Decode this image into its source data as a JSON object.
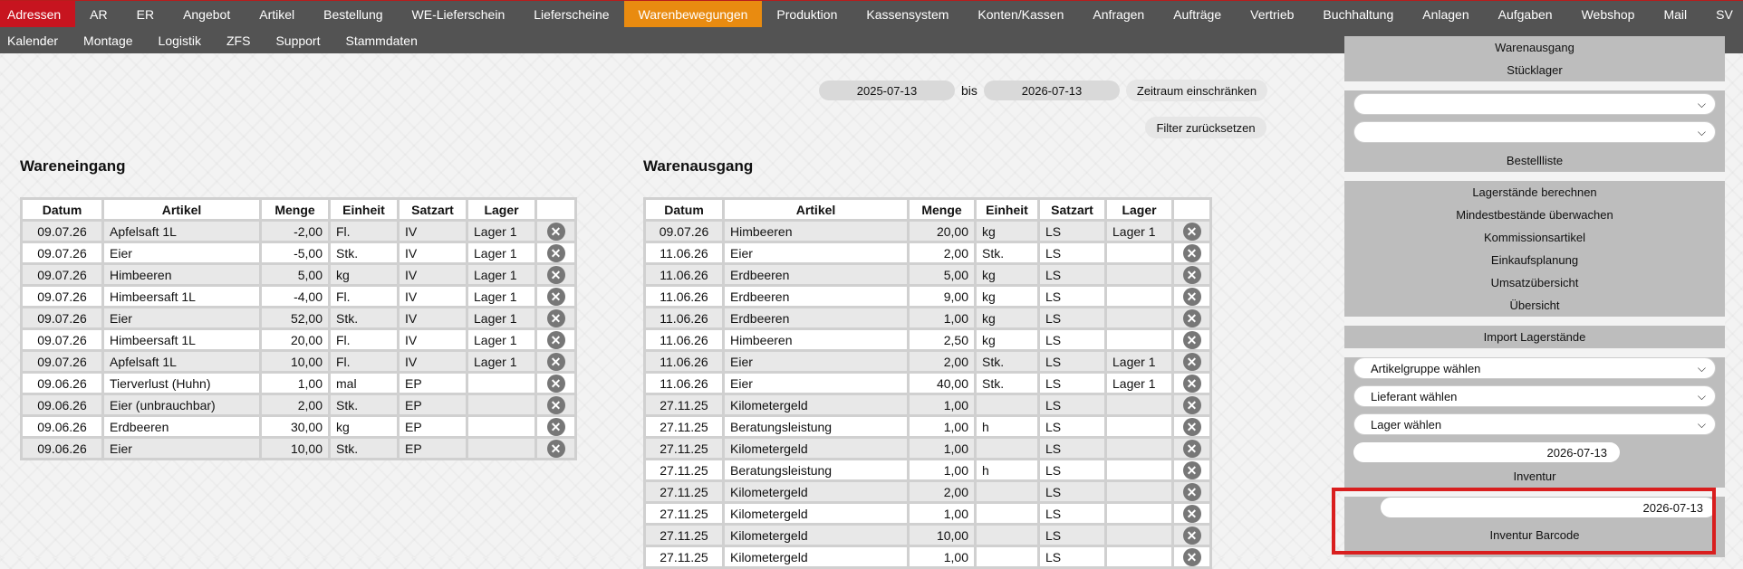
{
  "nav": {
    "row1": [
      "Adressen",
      "AR",
      "ER",
      "Angebot",
      "Artikel",
      "Bestellung",
      "WE-Lieferschein",
      "Lieferscheine",
      "Warenbewegungen",
      "Produktion",
      "Kassensystem",
      "Konten/Kassen",
      "Anfragen",
      "Aufträge",
      "Vertrieb",
      "Buchhaltung",
      "Anlagen",
      "Aufgaben",
      "Webshop",
      "Mail",
      "SV"
    ],
    "row2": [
      "Kalender",
      "Montage",
      "Logistik",
      "ZFS",
      "Support",
      "Stammdaten"
    ],
    "active": "Warenbewegungen",
    "highlighted": "Adressen"
  },
  "filter": {
    "date_from": "2025-07-13",
    "bis_label": "bis",
    "date_to": "2026-07-13",
    "restrict_label": "Zeitraum einschränken",
    "reset_label": "Filter zurücksetzen"
  },
  "wareneingang": {
    "title": "Wareneingang",
    "columns": [
      "Datum",
      "Artikel",
      "Menge",
      "Einheit",
      "Satzart",
      "Lager"
    ],
    "rows": [
      [
        "09.07.26",
        "Apfelsaft 1L",
        "-2,00",
        "Fl.",
        "IV",
        "Lager 1"
      ],
      [
        "09.07.26",
        "Eier",
        "-5,00",
        "Stk.",
        "IV",
        "Lager 1"
      ],
      [
        "09.07.26",
        "Himbeeren",
        "5,00",
        "kg",
        "IV",
        "Lager 1"
      ],
      [
        "09.07.26",
        "Himbeersaft 1L",
        "-4,00",
        "Fl.",
        "IV",
        "Lager 1"
      ],
      [
        "09.07.26",
        "Eier",
        "52,00",
        "Stk.",
        "IV",
        "Lager 1"
      ],
      [
        "09.07.26",
        "Himbeersaft 1L",
        "20,00",
        "Fl.",
        "IV",
        "Lager 1"
      ],
      [
        "09.07.26",
        "Apfelsaft 1L",
        "10,00",
        "Fl.",
        "IV",
        "Lager 1"
      ],
      [
        "09.06.26",
        "Tierverlust (Huhn)",
        "1,00",
        "mal",
        "EP",
        ""
      ],
      [
        "09.06.26",
        "Eier (unbrauchbar)",
        "2,00",
        "Stk.",
        "EP",
        ""
      ],
      [
        "09.06.26",
        "Erdbeeren",
        "30,00",
        "kg",
        "EP",
        ""
      ],
      [
        "09.06.26",
        "Eier",
        "10,00",
        "Stk.",
        "EP",
        ""
      ]
    ]
  },
  "warenausgang": {
    "title": "Warenausgang",
    "columns": [
      "Datum",
      "Artikel",
      "Menge",
      "Einheit",
      "Satzart",
      "Lager"
    ],
    "rows": [
      [
        "09.07.26",
        "Himbeeren",
        "20,00",
        "kg",
        "LS",
        "Lager 1"
      ],
      [
        "11.06.26",
        "Eier",
        "2,00",
        "Stk.",
        "LS",
        ""
      ],
      [
        "11.06.26",
        "Erdbeeren",
        "5,00",
        "kg",
        "LS",
        ""
      ],
      [
        "11.06.26",
        "Erdbeeren",
        "9,00",
        "kg",
        "LS",
        ""
      ],
      [
        "11.06.26",
        "Erdbeeren",
        "1,00",
        "kg",
        "LS",
        ""
      ],
      [
        "11.06.26",
        "Himbeeren",
        "2,50",
        "kg",
        "LS",
        ""
      ],
      [
        "11.06.26",
        "Eier",
        "2,00",
        "Stk.",
        "LS",
        "Lager 1"
      ],
      [
        "11.06.26",
        "Eier",
        "40,00",
        "Stk.",
        "LS",
        "Lager 1"
      ],
      [
        "27.11.25",
        "Kilometergeld",
        "1,00",
        "",
        "LS",
        ""
      ],
      [
        "27.11.25",
        "Beratungsleistung",
        "1,00",
        "h",
        "LS",
        ""
      ],
      [
        "27.11.25",
        "Kilometergeld",
        "1,00",
        "",
        "LS",
        ""
      ],
      [
        "27.11.25",
        "Beratungsleistung",
        "1,00",
        "h",
        "LS",
        ""
      ],
      [
        "27.11.25",
        "Kilometergeld",
        "2,00",
        "",
        "LS",
        ""
      ],
      [
        "27.11.25",
        "Kilometergeld",
        "1,00",
        "",
        "LS",
        ""
      ],
      [
        "27.11.25",
        "Kilometergeld",
        "10,00",
        "",
        "LS",
        ""
      ],
      [
        "27.11.25",
        "Kilometergeld",
        "1,00",
        "",
        "LS",
        ""
      ]
    ]
  },
  "sidebar": {
    "warenausgang": "Warenausgang",
    "stuecklager": "Stücklager",
    "select1_value": "",
    "select2_value": "",
    "bestellliste": "Bestellliste",
    "links": [
      "Lagerstände berechnen",
      "Mindestbestände überwachen",
      "Kommissionsartikel",
      "Einkaufsplanung",
      "Umsatzübersicht",
      "Übersicht"
    ],
    "import_lagerstaende": "Import Lagerstände",
    "artikelgruppe": "Artikelgruppe wählen",
    "lieferant": "Lieferant wählen",
    "lager": "Lager wählen",
    "stichtag": "2026-07-13",
    "inventur": "Inventur",
    "inventur_date": "2026-07-13",
    "inventur_barcode": "Inventur Barcode"
  },
  "colors": {
    "nav_bg": "#535353",
    "active": "#e98b10",
    "highlight": "#c7141f",
    "annotation": "#d91e1e"
  },
  "icons": {
    "delete": "close-circle-icon",
    "dropdown": "chevron-down-icon"
  }
}
